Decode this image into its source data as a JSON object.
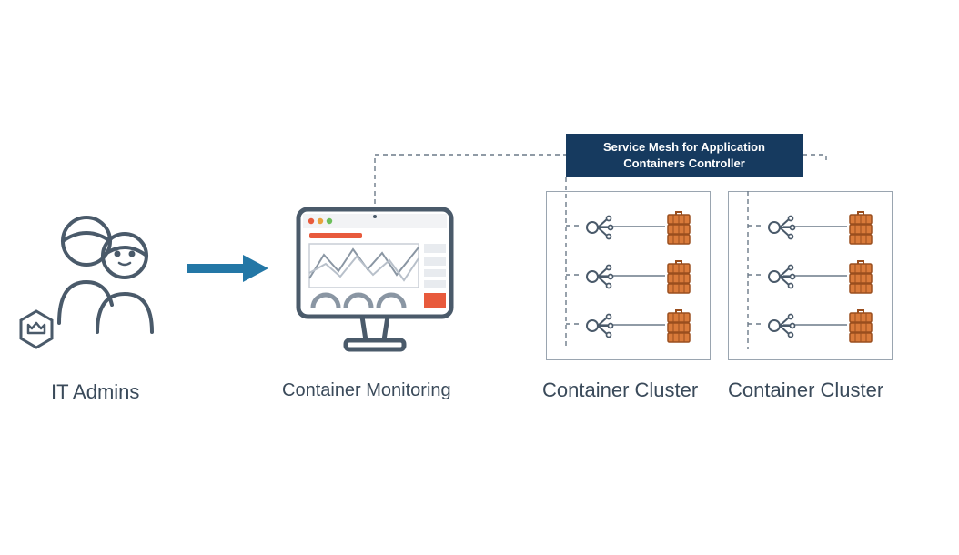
{
  "admins": {
    "label": "IT Admins"
  },
  "monitoring": {
    "label": "Container Monitoring"
  },
  "service_mesh": {
    "line1": "Service Mesh for Application",
    "line2": "Containers Controller"
  },
  "clusters": [
    {
      "label": "Container Cluster"
    },
    {
      "label": "Container Cluster"
    }
  ],
  "colors": {
    "banner": "#163a5f",
    "arrow": "#2377a6",
    "text": "#3a4a5a",
    "container": "#d97a3a",
    "container_dark": "#b35c26",
    "stroke": "#4a5a6a"
  },
  "icons": {
    "admins": "people-icon",
    "badge": "crown-hex-icon",
    "arrow": "arrow-right-icon",
    "monitor": "dashboard-monitor-icon",
    "lb": "load-balancer-icon",
    "stack": "container-stack-icon"
  }
}
